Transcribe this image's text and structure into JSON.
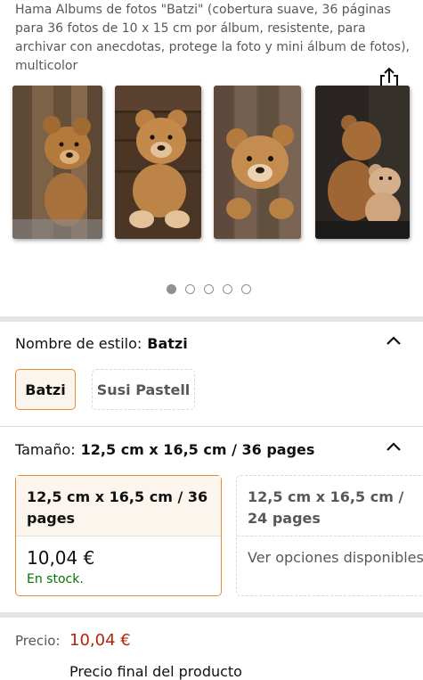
{
  "product": {
    "title": "Hama Albums de fotos \"Batzi\" (cobertura suave, 36 páginas para 36 fotos de 10 x 15 cm por álbum, resistente, para archivar con anecdotas, protege la foto y mini álbum de fotos), multicolor"
  },
  "gallery": {
    "image_count": 5,
    "active_index": 0,
    "share_icon": "share-icon"
  },
  "style": {
    "label": "Nombre de estilo:",
    "selected_value": "Batzi",
    "options": [
      "Batzi",
      "Susi Pastell"
    ]
  },
  "size": {
    "label": "Tamaño:",
    "selected_value": "12,5 cm x 16,5 cm / 36 pages",
    "options": [
      {
        "name": "12,5 cm x 16,5 cm / 36 pages",
        "price": "10,04 €",
        "availability": "En stock."
      },
      {
        "name": "12,5 cm x 16,5 cm / 24 pages",
        "note": "Ver opciones disponibles"
      }
    ]
  },
  "price": {
    "label": "Precio:",
    "value": "10,04 €",
    "final_label": "Precio final del producto"
  },
  "colors": {
    "accent_border": "#e48c33",
    "selected_bg": "#fcf5ee",
    "price_red": "#b12704",
    "stock_green": "#007600"
  }
}
